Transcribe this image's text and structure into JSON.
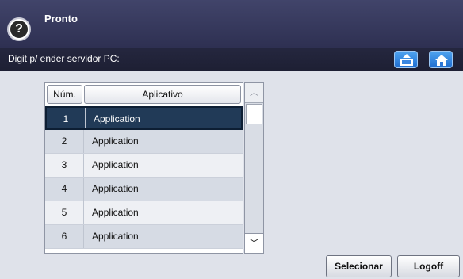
{
  "header": {
    "title": "Pronto",
    "help_symbol": "?"
  },
  "bar": {
    "text": "Digit p/ ender servidor PC:",
    "icons": [
      "upload-icon",
      "home-icon"
    ]
  },
  "table": {
    "headers": {
      "num": "Núm.",
      "app": "Aplicativo"
    },
    "rows": [
      {
        "num": "1",
        "app": "Application",
        "selected": true
      },
      {
        "num": "2",
        "app": "Application"
      },
      {
        "num": "3",
        "app": "Application"
      },
      {
        "num": "4",
        "app": "Application"
      },
      {
        "num": "5",
        "app": "Application"
      },
      {
        "num": "6",
        "app": "Application"
      }
    ]
  },
  "scrollbar": {
    "up_symbol": "︿",
    "down_symbol": "﹀"
  },
  "buttons": {
    "select": "Selecionar",
    "logoff": "Logoff"
  },
  "colors": {
    "header_bg": "#3a3d61",
    "selected_row": "#213a57",
    "accent_button": "#2b7fe0"
  }
}
